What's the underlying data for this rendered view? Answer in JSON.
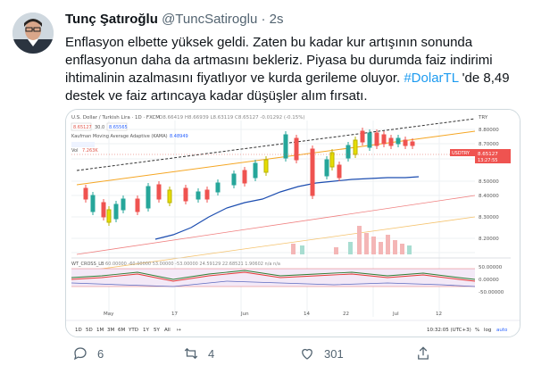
{
  "tweet": {
    "author_name": "Tunç Şatıroğlu",
    "author_handle": "@TuncSatiroglu",
    "separator": "·",
    "time": "2s",
    "text_1": "Enflasyon elbette yüksek geldi. Zaten bu kadar kur artışının sonunda enflasyonun daha da artmasını bekleriz. Piyasa bu durumda faiz indirimi ihtimalinin azalmasını fiyatlıyor ve kurda gerileme oluyor. ",
    "hashtag": "#DolarTL",
    "text_2": " 'de 8,49 destek ve faiz artıncaya kadar düşüşler alım fırsatı."
  },
  "chart": {
    "header": "U.S. Dollar / Turkish Lira · 1D · FXCM",
    "ohlc": "O8.66419 H8.66939 L8.63119 C8.65127 -0.01292 (-0.15%)",
    "input_1": "8.65127",
    "input_2": "30.0",
    "input_3": "8.65565",
    "indicator": "Kaufman Moving Average Adaptive (KAMA)",
    "indicator_value": "8.48949",
    "vol_label": "Vol",
    "vol_value": "7.263K",
    "last_price": "8.65127",
    "countdown": "13:27:55",
    "symbol_tag": "USDTRY",
    "currency": "TRY",
    "y_ticks": [
      "8.80000",
      "8.70000",
      "8.60000",
      "8.50000",
      "8.40000",
      "8.30000",
      "8.20000"
    ],
    "osc_title": "WT_CROSS_LB",
    "osc_values": "60.00000  -60.00000  53.00000  -53.00000  24.59129  22.68521  1.90602  n/a  n/a",
    "osc_ticks": [
      "50.00000",
      "0.00000",
      "-50.00000"
    ],
    "x_ticks": [
      "May",
      "17",
      "Jun",
      "14",
      "22",
      "Jul",
      "12"
    ],
    "timeframes": [
      "1D",
      "5D",
      "1M",
      "3M",
      "6M",
      "YTD",
      "1Y",
      "5Y",
      "All"
    ],
    "clock": "10:32:05 (UTC+3)",
    "scale_pct": "%",
    "scale_log": "log",
    "scale_auto": "auto"
  },
  "actions": {
    "reply_count": "6",
    "retweet_count": "4",
    "like_count": "301"
  }
}
